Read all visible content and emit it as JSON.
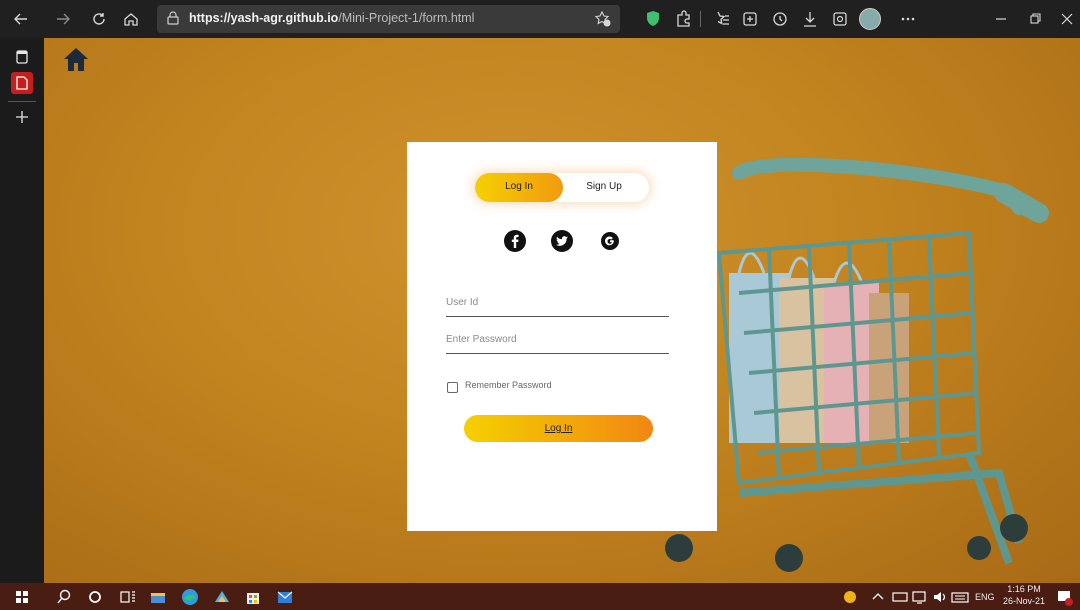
{
  "browser": {
    "url_domain": "https://yash-agr.github.io",
    "url_path": "/Mini-Project-1/form.html",
    "buttons": [
      "back",
      "forward",
      "refresh",
      "home"
    ],
    "toolbar_icons": [
      "favorites-add-icon",
      "shield-extension-icon",
      "extensions-icon",
      "favorites-icon",
      "collections-icon",
      "history-icon",
      "downloads-icon",
      "screenshot-icon",
      "profile-avatar",
      "more-icon"
    ],
    "window_controls": [
      "minimize",
      "restore",
      "close"
    ]
  },
  "sidebar": {
    "items": [
      "tab-actions",
      "active-tab",
      "new-tab"
    ]
  },
  "page": {
    "home_icon": "home-icon",
    "tabs": [
      {
        "label": "Log In",
        "active": true
      },
      {
        "label": "Sign Up",
        "active": false
      }
    ],
    "social_icons": [
      "facebook-icon",
      "twitter-icon",
      "google-icon"
    ],
    "fields": {
      "user_id_placeholder": "User Id",
      "password_placeholder": "Enter Password"
    },
    "remember_label": "Remember Password",
    "submit_label": "Log In",
    "colors": {
      "accent_start": "#f5d000",
      "accent_end": "#f28712",
      "background": "#c2841f",
      "card": "#ffffff"
    }
  },
  "taskbar": {
    "language": "ENG",
    "time": "1:16 PM",
    "date": "26-Nov-21",
    "icons": [
      "windows-start-icon",
      "search-icon",
      "cortana-icon",
      "task-view-icon",
      "file-explorer-icon",
      "edge-icon",
      "app-icon",
      "store-icon",
      "mail-icon"
    ]
  }
}
